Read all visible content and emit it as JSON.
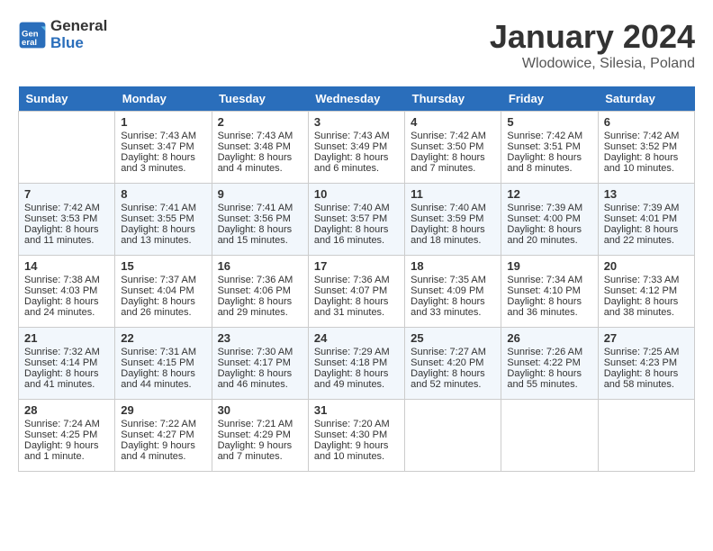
{
  "header": {
    "logo_general": "General",
    "logo_blue": "Blue",
    "month_title": "January 2024",
    "location": "Wlodowice, Silesia, Poland"
  },
  "days_of_week": [
    "Sunday",
    "Monday",
    "Tuesday",
    "Wednesday",
    "Thursday",
    "Friday",
    "Saturday"
  ],
  "weeks": [
    [
      {
        "day": "",
        "sunrise": "",
        "sunset": "",
        "daylight": ""
      },
      {
        "day": "1",
        "sunrise": "Sunrise: 7:43 AM",
        "sunset": "Sunset: 3:47 PM",
        "daylight": "Daylight: 8 hours and 3 minutes."
      },
      {
        "day": "2",
        "sunrise": "Sunrise: 7:43 AM",
        "sunset": "Sunset: 3:48 PM",
        "daylight": "Daylight: 8 hours and 4 minutes."
      },
      {
        "day": "3",
        "sunrise": "Sunrise: 7:43 AM",
        "sunset": "Sunset: 3:49 PM",
        "daylight": "Daylight: 8 hours and 6 minutes."
      },
      {
        "day": "4",
        "sunrise": "Sunrise: 7:42 AM",
        "sunset": "Sunset: 3:50 PM",
        "daylight": "Daylight: 8 hours and 7 minutes."
      },
      {
        "day": "5",
        "sunrise": "Sunrise: 7:42 AM",
        "sunset": "Sunset: 3:51 PM",
        "daylight": "Daylight: 8 hours and 8 minutes."
      },
      {
        "day": "6",
        "sunrise": "Sunrise: 7:42 AM",
        "sunset": "Sunset: 3:52 PM",
        "daylight": "Daylight: 8 hours and 10 minutes."
      }
    ],
    [
      {
        "day": "7",
        "sunrise": "Sunrise: 7:42 AM",
        "sunset": "Sunset: 3:53 PM",
        "daylight": "Daylight: 8 hours and 11 minutes."
      },
      {
        "day": "8",
        "sunrise": "Sunrise: 7:41 AM",
        "sunset": "Sunset: 3:55 PM",
        "daylight": "Daylight: 8 hours and 13 minutes."
      },
      {
        "day": "9",
        "sunrise": "Sunrise: 7:41 AM",
        "sunset": "Sunset: 3:56 PM",
        "daylight": "Daylight: 8 hours and 15 minutes."
      },
      {
        "day": "10",
        "sunrise": "Sunrise: 7:40 AM",
        "sunset": "Sunset: 3:57 PM",
        "daylight": "Daylight: 8 hours and 16 minutes."
      },
      {
        "day": "11",
        "sunrise": "Sunrise: 7:40 AM",
        "sunset": "Sunset: 3:59 PM",
        "daylight": "Daylight: 8 hours and 18 minutes."
      },
      {
        "day": "12",
        "sunrise": "Sunrise: 7:39 AM",
        "sunset": "Sunset: 4:00 PM",
        "daylight": "Daylight: 8 hours and 20 minutes."
      },
      {
        "day": "13",
        "sunrise": "Sunrise: 7:39 AM",
        "sunset": "Sunset: 4:01 PM",
        "daylight": "Daylight: 8 hours and 22 minutes."
      }
    ],
    [
      {
        "day": "14",
        "sunrise": "Sunrise: 7:38 AM",
        "sunset": "Sunset: 4:03 PM",
        "daylight": "Daylight: 8 hours and 24 minutes."
      },
      {
        "day": "15",
        "sunrise": "Sunrise: 7:37 AM",
        "sunset": "Sunset: 4:04 PM",
        "daylight": "Daylight: 8 hours and 26 minutes."
      },
      {
        "day": "16",
        "sunrise": "Sunrise: 7:36 AM",
        "sunset": "Sunset: 4:06 PM",
        "daylight": "Daylight: 8 hours and 29 minutes."
      },
      {
        "day": "17",
        "sunrise": "Sunrise: 7:36 AM",
        "sunset": "Sunset: 4:07 PM",
        "daylight": "Daylight: 8 hours and 31 minutes."
      },
      {
        "day": "18",
        "sunrise": "Sunrise: 7:35 AM",
        "sunset": "Sunset: 4:09 PM",
        "daylight": "Daylight: 8 hours and 33 minutes."
      },
      {
        "day": "19",
        "sunrise": "Sunrise: 7:34 AM",
        "sunset": "Sunset: 4:10 PM",
        "daylight": "Daylight: 8 hours and 36 minutes."
      },
      {
        "day": "20",
        "sunrise": "Sunrise: 7:33 AM",
        "sunset": "Sunset: 4:12 PM",
        "daylight": "Daylight: 8 hours and 38 minutes."
      }
    ],
    [
      {
        "day": "21",
        "sunrise": "Sunrise: 7:32 AM",
        "sunset": "Sunset: 4:14 PM",
        "daylight": "Daylight: 8 hours and 41 minutes."
      },
      {
        "day": "22",
        "sunrise": "Sunrise: 7:31 AM",
        "sunset": "Sunset: 4:15 PM",
        "daylight": "Daylight: 8 hours and 44 minutes."
      },
      {
        "day": "23",
        "sunrise": "Sunrise: 7:30 AM",
        "sunset": "Sunset: 4:17 PM",
        "daylight": "Daylight: 8 hours and 46 minutes."
      },
      {
        "day": "24",
        "sunrise": "Sunrise: 7:29 AM",
        "sunset": "Sunset: 4:18 PM",
        "daylight": "Daylight: 8 hours and 49 minutes."
      },
      {
        "day": "25",
        "sunrise": "Sunrise: 7:27 AM",
        "sunset": "Sunset: 4:20 PM",
        "daylight": "Daylight: 8 hours and 52 minutes."
      },
      {
        "day": "26",
        "sunrise": "Sunrise: 7:26 AM",
        "sunset": "Sunset: 4:22 PM",
        "daylight": "Daylight: 8 hours and 55 minutes."
      },
      {
        "day": "27",
        "sunrise": "Sunrise: 7:25 AM",
        "sunset": "Sunset: 4:23 PM",
        "daylight": "Daylight: 8 hours and 58 minutes."
      }
    ],
    [
      {
        "day": "28",
        "sunrise": "Sunrise: 7:24 AM",
        "sunset": "Sunset: 4:25 PM",
        "daylight": "Daylight: 9 hours and 1 minute."
      },
      {
        "day": "29",
        "sunrise": "Sunrise: 7:22 AM",
        "sunset": "Sunset: 4:27 PM",
        "daylight": "Daylight: 9 hours and 4 minutes."
      },
      {
        "day": "30",
        "sunrise": "Sunrise: 7:21 AM",
        "sunset": "Sunset: 4:29 PM",
        "daylight": "Daylight: 9 hours and 7 minutes."
      },
      {
        "day": "31",
        "sunrise": "Sunrise: 7:20 AM",
        "sunset": "Sunset: 4:30 PM",
        "daylight": "Daylight: 9 hours and 10 minutes."
      },
      {
        "day": "",
        "sunrise": "",
        "sunset": "",
        "daylight": ""
      },
      {
        "day": "",
        "sunrise": "",
        "sunset": "",
        "daylight": ""
      },
      {
        "day": "",
        "sunrise": "",
        "sunset": "",
        "daylight": ""
      }
    ]
  ]
}
